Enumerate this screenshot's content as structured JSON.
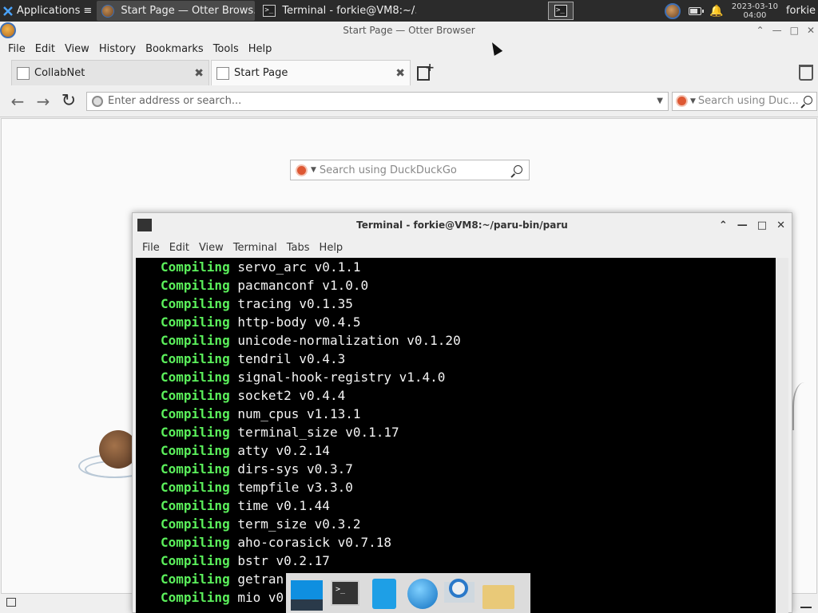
{
  "panel": {
    "apps_label": "Applications",
    "apps_suffix": "≡",
    "tasks": [
      {
        "label": "Start Page — Otter Brows..."
      },
      {
        "label": "Terminal - forkie@VM8:~/..."
      }
    ],
    "clock_date": "2023-03-10",
    "clock_time": "04:00",
    "user": "forkie"
  },
  "browser": {
    "title": "Start Page — Otter Browser",
    "menu": [
      "File",
      "Edit",
      "View",
      "History",
      "Bookmarks",
      "Tools",
      "Help"
    ],
    "tabs": [
      {
        "label": "CollabNet",
        "close": "✖"
      },
      {
        "label": "Start Page",
        "close": "✖"
      }
    ],
    "address_placeholder": "Enter address or search...",
    "search_placeholder": "Search using Duc...",
    "start_search_placeholder": "Search using DuckDuckGo"
  },
  "terminal": {
    "title": "Terminal - forkie@VM8:~/paru-bin/paru",
    "menu": [
      "File",
      "Edit",
      "View",
      "Terminal",
      "Tabs",
      "Help"
    ],
    "keyword": "Compiling",
    "lines": [
      "servo_arc v0.1.1",
      "pacmanconf v1.0.0",
      "tracing v0.1.35",
      "http-body v0.4.5",
      "unicode-normalization v0.1.20",
      "tendril v0.4.3",
      "signal-hook-registry v1.4.0",
      "socket2 v0.4.4",
      "num_cpus v1.13.1",
      "terminal_size v0.1.17",
      "atty v0.2.14",
      "dirs-sys v0.3.7",
      "tempfile v3.3.0",
      "time v0.1.44",
      "term_size v0.3.2",
      "aho-corasick v0.7.18",
      "bstr v0.2.17",
      "getran",
      "mio v0"
    ]
  },
  "dock": {
    "items": [
      {
        "name": "show-desktop"
      },
      {
        "name": "terminal"
      },
      {
        "name": "file-manager"
      },
      {
        "name": "web-browser"
      },
      {
        "name": "app-finder"
      },
      {
        "name": "home-folder"
      }
    ]
  },
  "colors": {
    "panel_bg": "#2b2b2b",
    "terminal_bg": "#000000",
    "terminal_keyword": "#5bf05b",
    "terminal_text": "#f4f4f4"
  }
}
